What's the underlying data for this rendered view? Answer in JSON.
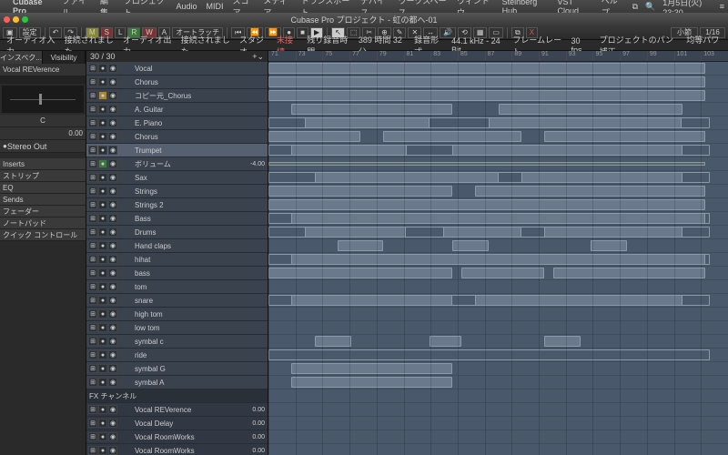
{
  "menubar": {
    "app": "Cubase Pro",
    "items": [
      "ファイル",
      "編集",
      "プロジェクト",
      "Audio",
      "MIDI",
      "スコア",
      "メディア",
      "トランスポート",
      "デバイス",
      "ワークスペース",
      "ウィンドウ",
      "Steinberg Hub",
      "VST Cloud",
      "ヘルプ"
    ],
    "clock": "1月5日(火) 23:30"
  },
  "window": {
    "title": "Cubase Pro プロジェクト - 虹の都へ-01",
    "dots": [
      "#ff5f56",
      "#ffbd2e",
      "#27c93f"
    ]
  },
  "toolbar": {
    "config": "設定",
    "msrw": [
      "M",
      "S",
      "L",
      "R",
      "W",
      "A"
    ],
    "automation": "オートラッチ",
    "transport": [
      "⏮",
      "⏪",
      "⏩",
      "●",
      "■",
      "▶"
    ],
    "tools": [
      "↖",
      "⬚",
      "✂",
      "⊕",
      "✎",
      "✕",
      "↔",
      "🔊",
      "⟲",
      "▦",
      "▭"
    ],
    "right_label": "小節",
    "right_val": "1/16"
  },
  "infobar": {
    "items": [
      "オーディオ入力",
      "接続されました",
      "オーディオ出力",
      "接続されました",
      "スタジオ",
      "未接続",
      "残り録音時間",
      "389 時間 32 分",
      "録音形式",
      "44.1 kHz - 24 Bit",
      "フレームレート",
      "30 fps",
      "プロジェクトのパン補正",
      "均等パワー"
    ]
  },
  "inspector": {
    "tabs": [
      "インスペク...",
      "Visibility"
    ],
    "channel": "Vocal REVerence",
    "pan": "C",
    "vol": "0.00",
    "out": "Stereo Out",
    "sections": [
      "Inserts",
      "ストリップ",
      "EQ",
      "Sends",
      "フェーダー",
      "ノートパッド",
      "クイック コントロール"
    ]
  },
  "tracklist_header": "30 / 30",
  "tracks": [
    {
      "name": "Vocal",
      "type": "audio"
    },
    {
      "name": "Chorus",
      "type": "audio"
    },
    {
      "name": "コピー元_Chorus",
      "type": "copy"
    },
    {
      "name": "A. Guitar",
      "type": "audio"
    },
    {
      "name": "E. Piano",
      "type": "audio"
    },
    {
      "name": "Chorus",
      "type": "audio"
    },
    {
      "name": "Trumpet",
      "type": "audio",
      "sel": true
    },
    {
      "name": "ボリューム",
      "type": "vol",
      "val": "-4.00"
    },
    {
      "name": "Sax",
      "type": "audio"
    },
    {
      "name": "Strings",
      "type": "audio"
    },
    {
      "name": "Strings 2",
      "type": "audio"
    },
    {
      "name": "Bass",
      "type": "audio"
    },
    {
      "name": "Drums",
      "type": "audio"
    },
    {
      "name": "Hand claps",
      "type": "audio"
    },
    {
      "name": "hihat",
      "type": "audio"
    },
    {
      "name": "bass",
      "type": "audio"
    },
    {
      "name": "tom",
      "type": "audio"
    },
    {
      "name": "snare",
      "type": "audio"
    },
    {
      "name": "high tom",
      "type": "audio"
    },
    {
      "name": "low tom",
      "type": "audio"
    },
    {
      "name": "symbal c",
      "type": "audio"
    },
    {
      "name": "ride",
      "type": "audio"
    },
    {
      "name": "symbal G",
      "type": "audio"
    },
    {
      "name": "symbal A",
      "type": "audio"
    },
    {
      "name": "FX チャンネル",
      "type": "header"
    },
    {
      "name": "Vocal REVerence",
      "type": "fx",
      "val": "0.00",
      "sel": true
    },
    {
      "name": "Vocal Delay",
      "type": "fx",
      "val": "0.00"
    },
    {
      "name": "Vocal RoomWorks",
      "type": "fx",
      "val": "0.00"
    },
    {
      "name": "Vocal RoomWorks",
      "type": "fx",
      "val": "0.00"
    }
  ],
  "ruler": [
    "71",
    "73",
    "75",
    "77",
    "79",
    "81",
    "83",
    "85",
    "87",
    "89",
    "91",
    "93",
    "95",
    "97",
    "99",
    "101",
    "103"
  ],
  "clips": {
    "0": [
      [
        0,
        95
      ]
    ],
    "1": [
      [
        0,
        95
      ]
    ],
    "2": [
      [
        0,
        95
      ]
    ],
    "3": [
      [
        5,
        40
      ],
      [
        50,
        90
      ]
    ],
    "4": [
      [
        0,
        96,
        "d"
      ],
      [
        8,
        35
      ],
      [
        48,
        90
      ]
    ],
    "5": [
      [
        0,
        20
      ],
      [
        25,
        55
      ],
      [
        60,
        95
      ]
    ],
    "6": [
      [
        0,
        96,
        "d"
      ],
      [
        5,
        30
      ],
      [
        40,
        90
      ]
    ],
    "7": [
      [
        0,
        95,
        "aut"
      ]
    ],
    "8": [
      [
        0,
        96,
        "d"
      ],
      [
        10,
        50
      ],
      [
        55,
        90
      ]
    ],
    "9": [
      [
        0,
        40
      ],
      [
        45,
        95
      ]
    ],
    "10": [
      [
        0,
        95
      ]
    ],
    "11": [
      [
        0,
        96,
        "d"
      ],
      [
        5,
        95
      ]
    ],
    "12": [
      [
        0,
        96,
        "d"
      ],
      [
        8,
        30
      ],
      [
        38,
        55
      ],
      [
        60,
        90
      ]
    ],
    "13": [
      [
        15,
        25
      ],
      [
        40,
        48
      ],
      [
        70,
        78
      ]
    ],
    "14": [
      [
        0,
        96,
        "d"
      ],
      [
        5,
        95
      ]
    ],
    "15": [
      [
        0,
        40
      ],
      [
        42,
        60
      ],
      [
        62,
        95
      ]
    ],
    "16": [],
    "17": [
      [
        0,
        96,
        "d"
      ],
      [
        5,
        40
      ],
      [
        45,
        90
      ]
    ],
    "18": [],
    "19": [],
    "20": [
      [
        10,
        18
      ],
      [
        35,
        42
      ],
      [
        60,
        68
      ]
    ],
    "21": [
      [
        0,
        96,
        "d"
      ]
    ],
    "22": [
      [
        5,
        40
      ]
    ],
    "23": [
      [
        5,
        40
      ]
    ]
  }
}
